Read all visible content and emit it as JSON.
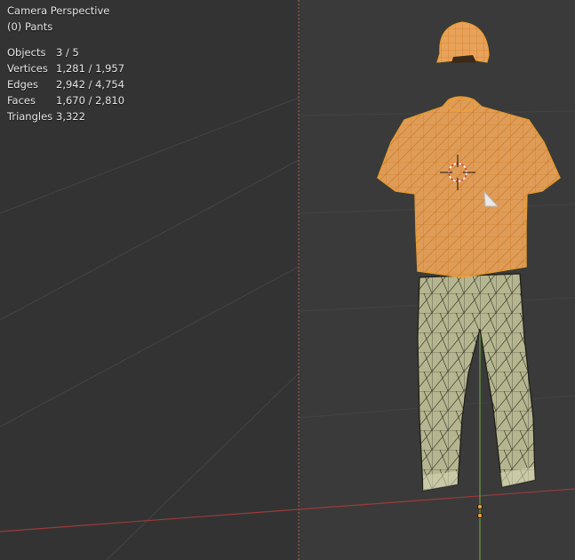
{
  "overlay": {
    "view_name": "Camera Perspective",
    "active_object": "(0) Pants"
  },
  "stats": [
    {
      "label": "Objects",
      "value": "3 / 5"
    },
    {
      "label": "Vertices",
      "value": "1,281 / 1,957"
    },
    {
      "label": "Edges",
      "value": "2,942 / 4,754"
    },
    {
      "label": "Faces",
      "value": "1,670 / 2,810"
    },
    {
      "label": "Triangles",
      "value": "3,322"
    }
  ],
  "scene": {
    "objects": [
      "cap",
      "shirt",
      "pants"
    ],
    "selected_color": "#f0a030",
    "pants_color": "#b5b690",
    "axis_x_color": "#9e3a3a",
    "axis_y_color": "#6f9a3e"
  }
}
